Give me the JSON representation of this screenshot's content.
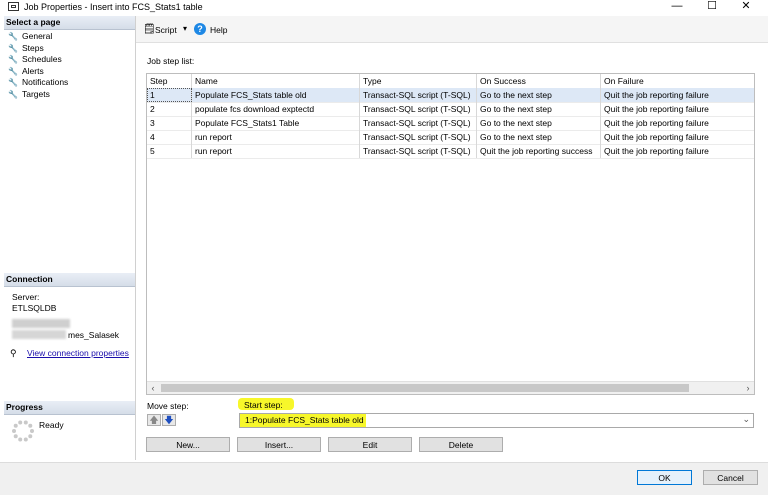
{
  "window": {
    "title": "Job Properties - Insert into FCS_Stats1 table",
    "minimize": "—",
    "maximize": "☐",
    "close": "✕"
  },
  "left": {
    "select_page_header": "Select a page",
    "pages": [
      "General",
      "Steps",
      "Schedules",
      "Alerts",
      "Notifications",
      "Targets"
    ],
    "connection_header": "Connection",
    "server_label": "Server:",
    "server_value": "ETLSQLDB",
    "connection_user": "mes_Salasek",
    "view_connection_link": "View connection properties",
    "progress_header": "Progress",
    "progress_status": "Ready"
  },
  "toolbar": {
    "script_label": "Script",
    "help_label": "Help"
  },
  "steps": {
    "list_label": "Job step list:",
    "columns": [
      "Step",
      "Name",
      "Type",
      "On Success",
      "On Failure"
    ],
    "rows": [
      [
        "1",
        "Populate FCS_Stats table old",
        "Transact-SQL script (T-SQL)",
        "Go to the next step",
        "Quit the job reporting failure"
      ],
      [
        "2",
        "populate fcs download exptectd",
        "Transact-SQL script (T-SQL)",
        "Go to the next step",
        "Quit the job reporting failure"
      ],
      [
        "3",
        "Populate FCS_Stats1 Table",
        "Transact-SQL script (T-SQL)",
        "Go to the next step",
        "Quit the job reporting failure"
      ],
      [
        "4",
        "run report",
        "Transact-SQL script (T-SQL)",
        "Go to the next step",
        "Quit the job reporting failure"
      ],
      [
        "5",
        "run report",
        "Transact-SQL script (T-SQL)",
        "Quit the job reporting success",
        "Quit the job reporting failure"
      ]
    ],
    "selected_row": 0
  },
  "move_step_label": "Move step:",
  "start_step_label": "Start step:",
  "start_step_value": "1:Populate FCS_Stats table old",
  "buttons": {
    "new": "New...",
    "insert": "Insert...",
    "edit": "Edit",
    "delete": "Delete",
    "ok": "OK",
    "cancel": "Cancel"
  },
  "colors": {
    "highlight": "#f7f72a",
    "selection": "#dde8f6",
    "link": "#1a0dab",
    "help_icon": "#1e88e5"
  }
}
